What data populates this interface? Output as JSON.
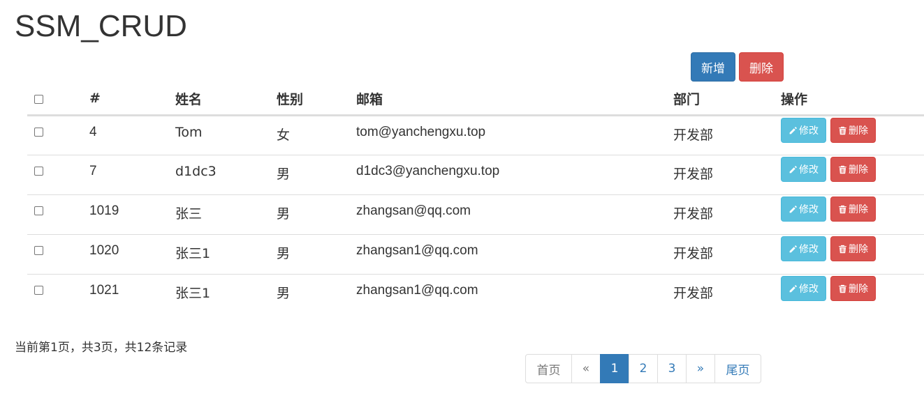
{
  "header": {
    "title": "SSM_CRUD"
  },
  "toolbar": {
    "add_label": "新增",
    "delete_label": "删除"
  },
  "table": {
    "columns": [
      "#",
      "姓名",
      "性别",
      "邮箱",
      "部门",
      "操作"
    ],
    "rows": [
      {
        "id": "4",
        "name": "Tom",
        "gender": "女",
        "email": "tom@yanchengxu.top",
        "dept": "开发部"
      },
      {
        "id": "7",
        "name": "d1dc3",
        "gender": "男",
        "email": "d1dc3@yanchengxu.top",
        "dept": "开发部"
      },
      {
        "id": "1019",
        "name": "张三",
        "gender": "男",
        "email": "zhangsan@qq.com",
        "dept": "开发部"
      },
      {
        "id": "1020",
        "name": "张三1",
        "gender": "男",
        "email": "zhangsan1@qq.com",
        "dept": "开发部"
      },
      {
        "id": "1021",
        "name": "张三1",
        "gender": "男",
        "email": "zhangsan1@qq.com",
        "dept": "开发部"
      }
    ],
    "edit_label": "修改",
    "row_delete_label": "删除"
  },
  "pagination": {
    "info": "当前第1页，共3页，共12条记录",
    "first_label": "首页",
    "prev_label": "«",
    "pages": [
      "1",
      "2",
      "3"
    ],
    "current_page": "1",
    "next_label": "»",
    "last_label": "尾页"
  },
  "colors": {
    "primary": "#337ab7",
    "danger": "#d9534f",
    "info": "#5bc0de"
  },
  "icons": {
    "edit": "pencil-icon",
    "delete": "trash-icon"
  }
}
